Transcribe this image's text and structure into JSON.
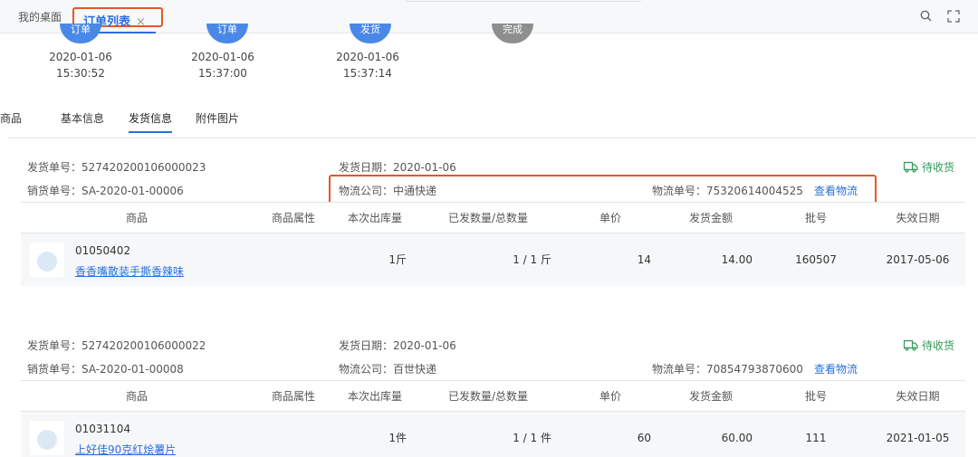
{
  "tabs": {
    "home": "我的桌面",
    "active": "订单列表",
    "close": "×"
  },
  "flow": {
    "steps": [
      {
        "label": "订单",
        "date": "2020-01-06",
        "time": "15:30:52",
        "color": "#4a88e8"
      },
      {
        "label": "订单",
        "date": "2020-01-06",
        "time": "15:37:00",
        "color": "#4a88e8"
      },
      {
        "label": "发货",
        "date": "2020-01-06",
        "time": "15:37:14",
        "color": "#4a88e8"
      },
      {
        "label": "完成",
        "color": "#8e8e8e"
      }
    ]
  },
  "subtabs": [
    "商品",
    "基本信息",
    "发货信息",
    "附件图片"
  ],
  "active_subtab": "发货信息",
  "labels": {
    "ship_no": "发货单号：",
    "sale_no": "销货单号：",
    "ship_date": "发货日期：",
    "carrier": "物流公司：",
    "track_no": "物流单号：",
    "view_track": "查看物流"
  },
  "columns": [
    "商品",
    "商品属性",
    "本次出库量",
    "已发数量/总数量",
    "单价",
    "发货金额",
    "批号",
    "失效日期"
  ],
  "shipments": [
    {
      "ship_no": "527420200106000023",
      "sale_no": "SA-2020-01-00006",
      "ship_date": "2020-01-06",
      "carrier": "中通快递",
      "track_no": "75320614004525",
      "status": "待收货",
      "row": {
        "code": "01050402",
        "name": "香香嘴散装手撕香辣味",
        "attr": "",
        "qty": "1斤",
        "shipped": "1 / 1 斤",
        "price": "14",
        "amount": "14.00",
        "batch": "160507",
        "expiry": "2017-05-06"
      }
    },
    {
      "ship_no": "527420200106000022",
      "sale_no": "SA-2020-01-00008",
      "ship_date": "2020-01-06",
      "carrier": "百世快递",
      "track_no": "70854793870600",
      "status": "待收货",
      "row": {
        "code": "01031104",
        "name": "上好佳90克红烩薯片",
        "attr": "",
        "qty": "1件",
        "shipped": "1 / 1 件",
        "price": "60",
        "amount": "60.00",
        "batch": "111",
        "expiry": "2021-01-05"
      }
    }
  ],
  "colors": {
    "accent": "#2a6fdb",
    "highlight": "#e05a2b",
    "status_green": "#2e9b5a"
  }
}
